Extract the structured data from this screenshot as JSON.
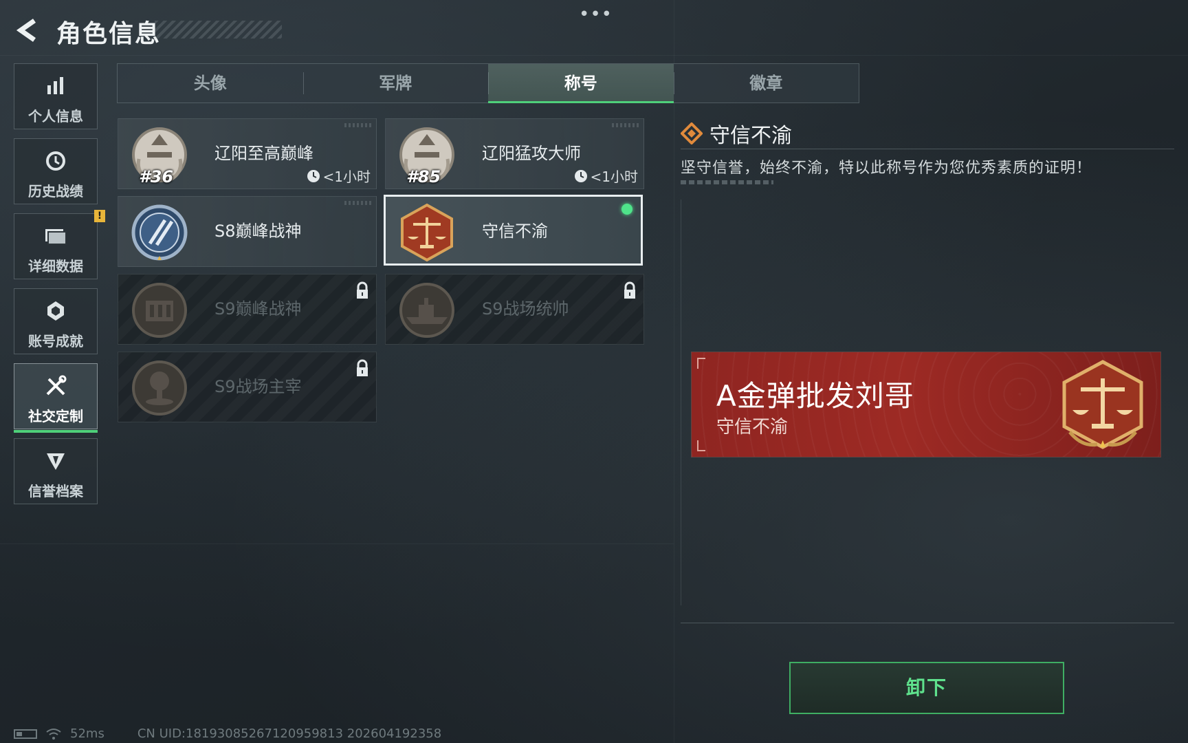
{
  "header": {
    "title": "角色信息",
    "menu_dots": "•••"
  },
  "sidebar": {
    "items": [
      {
        "label": "个人信息",
        "icon": "bar-chart-icon"
      },
      {
        "label": "历史战绩",
        "icon": "history-clock-icon"
      },
      {
        "label": "详细数据",
        "icon": "folder-icon",
        "badge": "!"
      },
      {
        "label": "账号成就",
        "icon": "achievement-icon"
      },
      {
        "label": "社交定制",
        "icon": "tools-icon",
        "active": true
      },
      {
        "label": "信誉档案",
        "icon": "credit-shield-icon"
      }
    ]
  },
  "tabs": [
    {
      "label": "头像"
    },
    {
      "label": "军牌"
    },
    {
      "label": "称号",
      "active": true
    },
    {
      "label": "徽章"
    }
  ],
  "titles": [
    {
      "name": "辽阳至高巅峰",
      "rank": "#36",
      "time": "<1小时",
      "state": "owned"
    },
    {
      "name": "辽阳猛攻大师",
      "rank": "#85",
      "time": "<1小时",
      "state": "owned"
    },
    {
      "name": "S8巅峰战神",
      "state": "owned"
    },
    {
      "name": "守信不渝",
      "state": "equipped"
    },
    {
      "name": "S9巅峰战神",
      "state": "locked"
    },
    {
      "name": "S9战场统帅",
      "state": "locked"
    },
    {
      "name": "S9战场主宰",
      "state": "locked"
    }
  ],
  "detail": {
    "title": "守信不渝",
    "description": "坚守信誉，始终不渝，特以此称号作为您优秀素质的证明！"
  },
  "banner": {
    "player_name": "A金弹批发刘哥",
    "title": "守信不渝"
  },
  "actions": {
    "unequip_label": "卸下"
  },
  "footer": {
    "ping": "52ms",
    "uid": "CN UID:18193085267120959813 202604192358"
  },
  "colors": {
    "accent_green": "#4fd07a",
    "banner_red": "#9d2a24",
    "warning_yellow": "#e8b53a"
  }
}
